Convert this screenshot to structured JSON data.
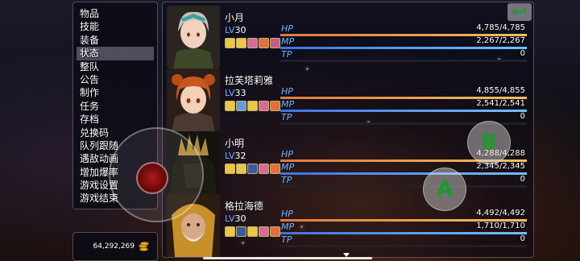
{
  "menu": {
    "items": [
      "物品",
      "技能",
      "装备",
      "状态",
      "整队",
      "公告",
      "制作",
      "任务",
      "存档",
      "兑换码",
      "队列跟随",
      "遇敌动画",
      "增加爆率",
      "游戏设置",
      "游戏结束"
    ],
    "selected_index": 3
  },
  "gold": {
    "amount": "64,292,269",
    "icon": "gold-coin-stack-icon"
  },
  "actors": [
    {
      "name": "小月",
      "level_label": "LV",
      "level": "30",
      "hp_label": "HP",
      "hp": "4,785/4,785",
      "hp_ratio": 1.0,
      "mp_label": "MP",
      "mp": "2,267/2,267",
      "mp_ratio": 1.0,
      "tp_label": "TP",
      "tp": "0",
      "tp_ratio": 0,
      "status_icons": [
        "buff-icon",
        "buff-icon",
        "buff-icon",
        "buff-icon",
        "buff-icon"
      ]
    },
    {
      "name": "拉芙塔莉雅",
      "level_label": "LV",
      "level": "33",
      "hp_label": "HP",
      "hp": "4,855/4,855",
      "hp_ratio": 1.0,
      "mp_label": "MP",
      "mp": "2,541/2,541",
      "mp_ratio": 1.0,
      "tp_label": "TP",
      "tp": "0",
      "tp_ratio": 0,
      "status_icons": [
        "buff-icon",
        "buff-icon",
        "buff-icon",
        "buff-icon",
        "buff-icon"
      ]
    },
    {
      "name": "小明",
      "level_label": "LV",
      "level": "32",
      "hp_label": "HP",
      "hp": "4,288/4,288",
      "hp_ratio": 1.0,
      "mp_label": "MP",
      "mp": "2,345/2,345",
      "mp_ratio": 1.0,
      "tp_label": "TP",
      "tp": "0",
      "tp_ratio": 0,
      "status_icons": [
        "buff-icon",
        "buff-icon",
        "buff-icon",
        "buff-icon",
        "buff-icon"
      ]
    },
    {
      "name": "格拉海德",
      "level_label": "LV",
      "level": "30",
      "hp_label": "HP",
      "hp": "4,492/4,492",
      "hp_ratio": 1.0,
      "mp_label": "MP",
      "mp": "1,710/1,710",
      "mp_ratio": 1.0,
      "tp_label": "TP",
      "tp": "0",
      "tp_ratio": 0,
      "status_icons": [
        "buff-icon",
        "buff-icon",
        "buff-icon",
        "buff-icon",
        "buff-icon"
      ]
    }
  ],
  "controls": {
    "b_label": "B",
    "a_label": "A",
    "menu_label": "Quit"
  },
  "colors": {
    "stat_label": "#6fb4ff",
    "hp": "#e07840",
    "mp": "#4070e0",
    "tp": "#30a040",
    "button_glyph": "#1a9a2a"
  }
}
